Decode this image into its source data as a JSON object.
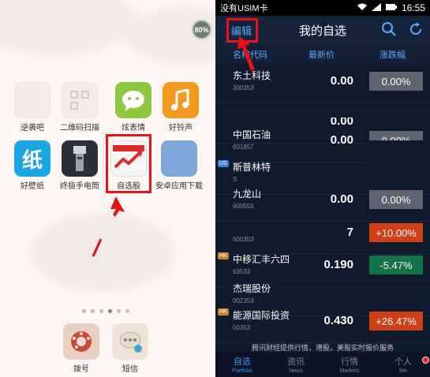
{
  "left": {
    "battery_badge": "80%",
    "apps_row1": [
      {
        "label": "逆袭吧",
        "icon": "blurred-app-icon",
        "style": "ghost"
      },
      {
        "label": "二维码扫描",
        "icon": "qr-scan-icon",
        "style": "ghost"
      },
      {
        "label": "炫表情",
        "icon": "chat-bubble-icon",
        "style": "green"
      },
      {
        "label": "好铃声",
        "icon": "music-note-icon",
        "style": "orange"
      }
    ],
    "apps_row2": [
      {
        "label": "好壁纸",
        "icon": "wallpaper-icon",
        "style": "blue",
        "glyph": "纸"
      },
      {
        "label": "终极手电筒",
        "icon": "flashlight-icon",
        "style": "dark"
      },
      {
        "label": "自选股",
        "icon": "stock-chart-icon",
        "style": "stock"
      },
      {
        "label": "安卓应用下载",
        "icon": "android-store-icon",
        "style": "partial"
      }
    ],
    "dock": [
      {
        "label": "拨号",
        "icon": "rotary-dial-icon"
      },
      {
        "label": "短信",
        "icon": "sms-bubble-icon"
      }
    ],
    "page_dots": 6,
    "active_dot": 3
  },
  "right": {
    "status": {
      "carrier": "没有USIM卡",
      "time": "16:55"
    },
    "nav": {
      "edit": "编辑",
      "title": "我的自选"
    },
    "columns": {
      "name": "名称代码",
      "price": "最新价",
      "change": "涨跌幅"
    },
    "rows": [
      {
        "name": "东土科技",
        "code": "300353",
        "price": "0.00",
        "change": "0.00%",
        "color": "gray",
        "tag": ""
      },
      {
        "name": "",
        "code": "",
        "price": "0.00",
        "change": "",
        "color": "",
        "tag": ""
      },
      {
        "name": "中国石油",
        "code": "601857",
        "price": "0.00",
        "change": "0.00%",
        "color": "gray",
        "tag": ""
      },
      {
        "name": "斯普林特",
        "code": "S",
        "price": "",
        "change": "",
        "color": "",
        "tag": "US"
      },
      {
        "name": "九龙山",
        "code": "600555",
        "price": "0.00",
        "change": "0.00%",
        "color": "gray",
        "tag": ""
      },
      {
        "name": "",
        "code": "600353",
        "price": "7",
        "change": "+10.00%",
        "color": "red",
        "tag": ""
      },
      {
        "name": "中移汇丰六四",
        "code": "63533",
        "price": "0.190",
        "change": "-5.47%",
        "color": "green",
        "tag": "HK"
      },
      {
        "name": "杰瑞股份",
        "code": "002353",
        "price": "",
        "change": "",
        "color": "",
        "tag": ""
      },
      {
        "name": "能源国际投资",
        "code": "00353",
        "price": "0.430",
        "change": "+26.47%",
        "color": "red",
        "tag": "HK"
      }
    ],
    "ticker": "腾讯财经提供行情，港股，美股实时报价服务",
    "tabs": [
      {
        "label": "自选",
        "sub": "Portfolio",
        "active": true
      },
      {
        "label": "资讯",
        "sub": "News",
        "active": false
      },
      {
        "label": "行情",
        "sub": "Markets",
        "active": false
      },
      {
        "label": "个人",
        "sub": "Me",
        "active": false
      }
    ]
  }
}
